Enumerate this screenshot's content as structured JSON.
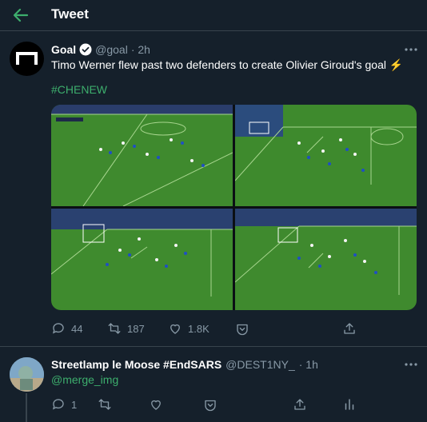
{
  "header": {
    "title": "Tweet"
  },
  "tweet": {
    "author_name": "Goal",
    "handle": "@goal",
    "time": "· 2h",
    "text": "Timo Werner flew past two defenders to create Olivier Giroud's goal ⚡",
    "hashtag": "#CHENEW",
    "stats": {
      "replies": "44",
      "retweets": "187",
      "likes": "1.8K"
    }
  },
  "reply": {
    "author_name": "Streetlamp le Moose #EndSARS",
    "handle": "@DEST1NY_",
    "time": "· 1h",
    "mention": "@merge_img",
    "stats": {
      "replies": "1"
    }
  },
  "colors": {
    "background": "#15202b",
    "accent": "#3dae6d",
    "muted": "#8899a6",
    "divider": "#38444d"
  },
  "icons": [
    "back-arrow-icon",
    "verified-icon",
    "more-icon",
    "reply-icon",
    "retweet-icon",
    "like-icon",
    "bookmark-icon",
    "share-icon",
    "analytics-icon"
  ]
}
